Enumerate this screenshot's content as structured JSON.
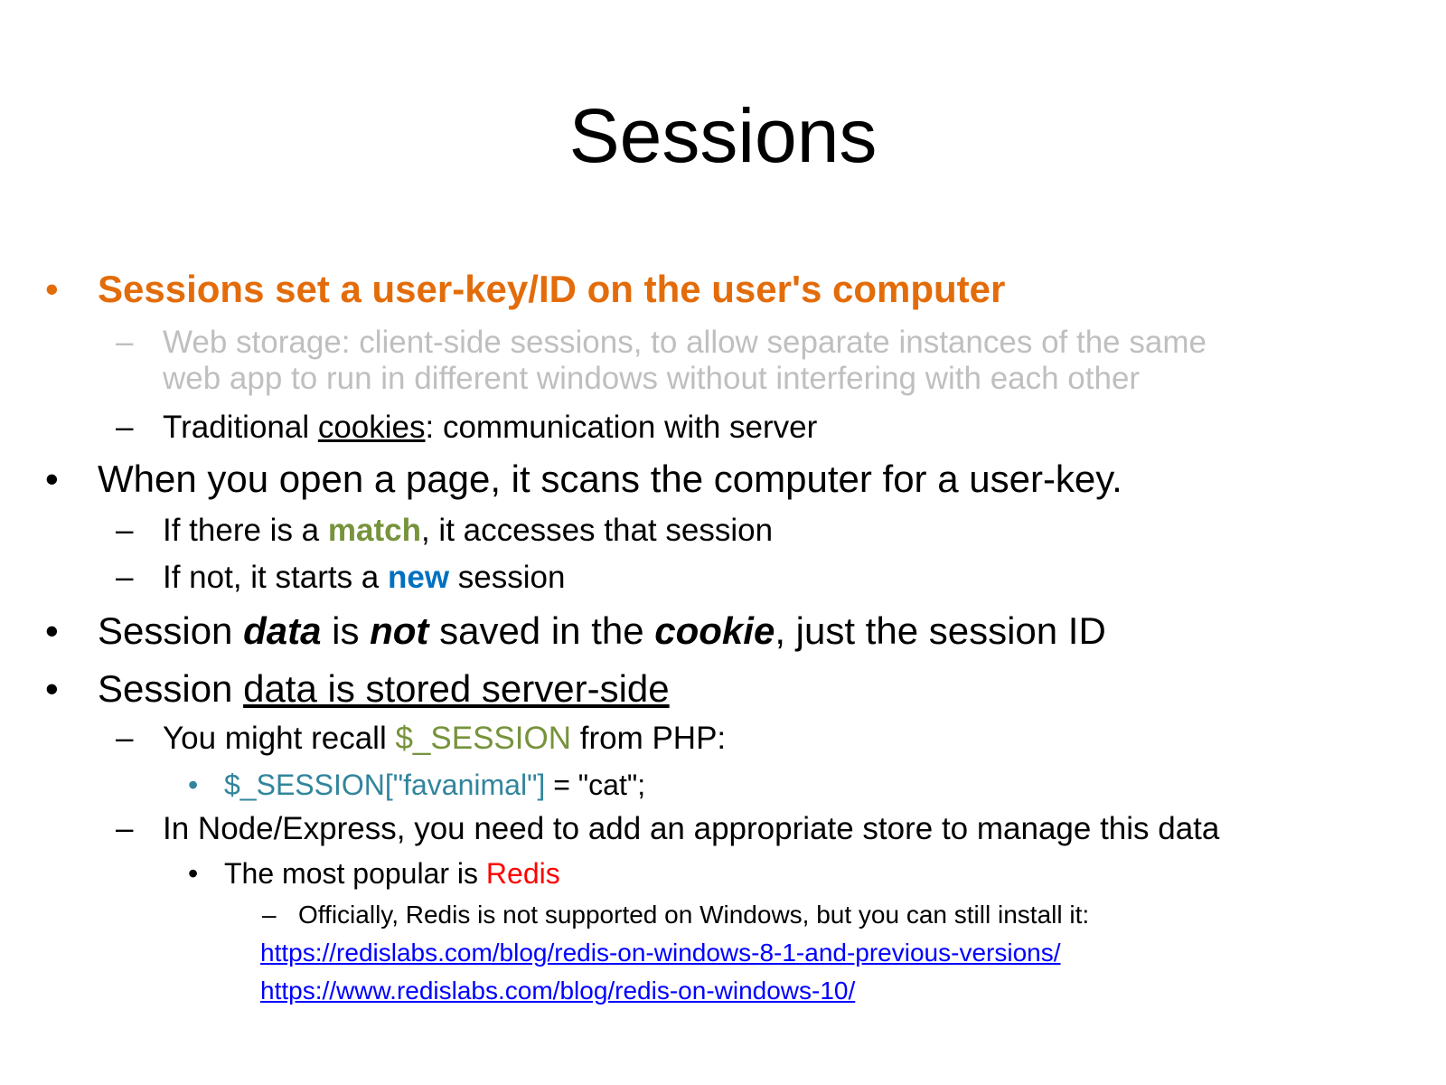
{
  "title": "Sessions",
  "bullets": {
    "b1": "Sessions set a user-key/ID on the user's computer",
    "b1_sub1_line1": "Web storage: client-side sessions, to allow separate instances of the same",
    "b1_sub1_line2": "web app to run in different windows without interfering with each other",
    "b1_sub2_pre": "Traditional ",
    "b1_sub2_ul": "cookies",
    "b1_sub2_post": ": communication with server",
    "b2": "When you open a page, it scans the computer for a user-key.",
    "b2_sub1_pre": "If there is a ",
    "b2_sub1_em": "match",
    "b2_sub1_post": ", it accesses that session",
    "b2_sub2_pre": "If not, it starts a ",
    "b2_sub2_em": "new",
    "b2_sub2_post": " session",
    "b3_a": "Session ",
    "b3_b": "data",
    "b3_c": " is ",
    "b3_d": "not",
    "b3_e": " saved in the ",
    "b3_f": "cookie",
    "b3_g": ", just the session ID",
    "b4_pre": "Session ",
    "b4_ul": "data is stored server-side",
    "b4_sub1_pre": "You might recall ",
    "b4_sub1_code": "$_SESSION",
    "b4_sub1_post": " from PHP:",
    "b4_sub1_sub_code": "$_SESSION[\"favanimal\"]",
    "b4_sub1_sub_post": " = \"cat\";",
    "b4_sub2": "In Node/Express, you need to add an appropriate store to manage this data",
    "b4_sub2_sub_pre": "The most popular is ",
    "b4_sub2_sub_red": "Redis",
    "b4_sub2_sub_sub": "Officially, Redis is not supported on Windows, but you can still install it:",
    "link1": "https://redislabs.com/blog/redis-on-windows-8-1-and-previous-versions/",
    "link2": "https://www.redislabs.com/blog/redis-on-windows-10/"
  },
  "markers": {
    "dot": "•",
    "dash": "–"
  },
  "colors": {
    "orange": "#e36c0a",
    "grey": "#bfbfbf",
    "green": "#77933c",
    "blue": "#0070c0",
    "teal": "#31859c",
    "red": "#ff0000",
    "link": "#0000ff"
  }
}
